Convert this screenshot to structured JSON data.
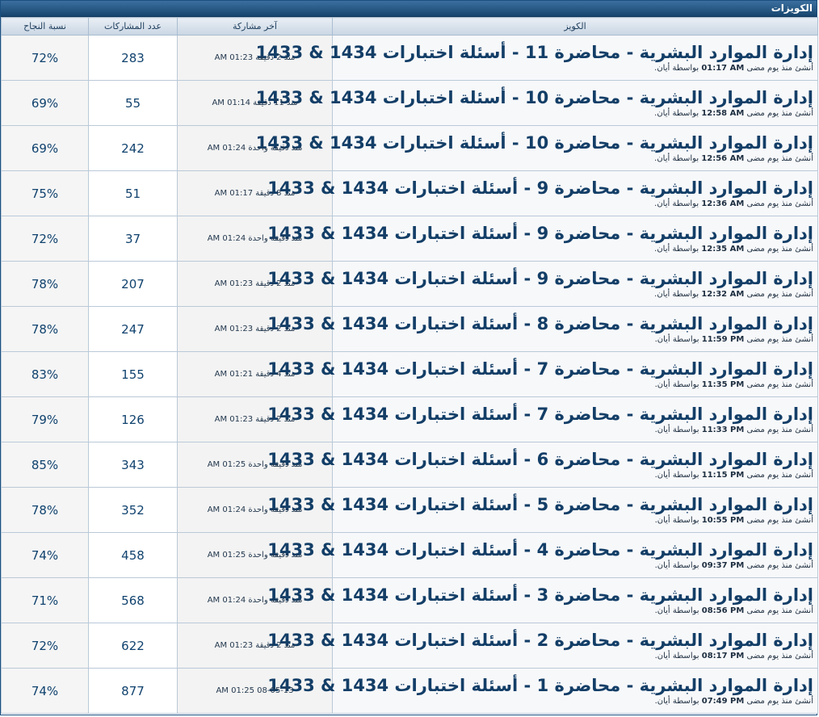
{
  "section": {
    "title": "الكويزات"
  },
  "columns": {
    "quiz": "الكويز",
    "last_post": "آخر مشاركة",
    "participants": "عدد المشاركات",
    "success_rate": "نسبة النجاح"
  },
  "rows": [
    {
      "title": "إدارة الموارد البشرية - محاضرة 11 - أسئلة اختبارات 1434 & 1433",
      "created_prefix": "أنشئ منذ يوم مضى",
      "created_time": "01:17 AM",
      "by": "بواسطة أيان.",
      "last_post": "منذ 2 دقيقة 01:23 AM",
      "participants": "283",
      "success_rate": "72%"
    },
    {
      "title": "إدارة الموارد البشرية - محاضرة 10 - أسئلة اختبارات 1434 & 1433",
      "created_prefix": "أنشئ منذ يوم مضى",
      "created_time": "12:58 AM",
      "by": "بواسطة أيان.",
      "last_post": "منذ 11 دقيقة 01:14 AM",
      "participants": "55",
      "success_rate": "69%"
    },
    {
      "title": "إدارة الموارد البشرية - محاضرة 10 - أسئلة اختبارات 1434 & 1433",
      "created_prefix": "أنشئ منذ يوم مضى",
      "created_time": "12:56 AM",
      "by": "بواسطة أيان.",
      "last_post": "منذ دقيقة واحدة 01:24 AM",
      "participants": "242",
      "success_rate": "69%"
    },
    {
      "title": "إدارة الموارد البشرية - محاضرة 9 - أسئلة اختبارات 1434 & 1433",
      "created_prefix": "أنشئ منذ يوم مضى",
      "created_time": "12:36 AM",
      "by": "بواسطة أيان.",
      "last_post": "منذ 8 دقيقة 01:17 AM",
      "participants": "51",
      "success_rate": "75%"
    },
    {
      "title": "إدارة الموارد البشرية - محاضرة 9 - أسئلة اختبارات 1434 & 1433",
      "created_prefix": "أنشئ منذ يوم مضى",
      "created_time": "12:35 AM",
      "by": "بواسطة أيان.",
      "last_post": "منذ دقيقة واحدة 01:24 AM",
      "participants": "37",
      "success_rate": "72%"
    },
    {
      "title": "إدارة الموارد البشرية - محاضرة 9 - أسئلة اختبارات 1434 & 1433",
      "created_prefix": "أنشئ منذ يوم مضى",
      "created_time": "12:32 AM",
      "by": "بواسطة أيان.",
      "last_post": "منذ 2 دقيقة 01:23 AM",
      "participants": "207",
      "success_rate": "78%"
    },
    {
      "title": "إدارة الموارد البشرية - محاضرة 8 - أسئلة اختبارات 1434 & 1433",
      "created_prefix": "أنشئ منذ يوم مضى",
      "created_time": "11:59 PM",
      "by": "بواسطة أيان.",
      "last_post": "منذ 2 دقيقة 01:23 AM",
      "participants": "247",
      "success_rate": "78%"
    },
    {
      "title": "إدارة الموارد البشرية - محاضرة 7 - أسئلة اختبارات 1434 & 1433",
      "created_prefix": "أنشئ منذ يوم مضى",
      "created_time": "11:35 PM",
      "by": "بواسطة أيان.",
      "last_post": "منذ 4 دقيقة 01:21 AM",
      "participants": "155",
      "success_rate": "83%"
    },
    {
      "title": "إدارة الموارد البشرية - محاضرة 7 - أسئلة اختبارات 1434 & 1433",
      "created_prefix": "أنشئ منذ يوم مضى",
      "created_time": "11:33 PM",
      "by": "بواسطة أيان.",
      "last_post": "منذ 2 دقيقة 01:23 AM",
      "participants": "126",
      "success_rate": "79%"
    },
    {
      "title": "إدارة الموارد البشرية - محاضرة 6 - أسئلة اختبارات 1434 & 1433",
      "created_prefix": "أنشئ منذ يوم مضى",
      "created_time": "11:15 PM",
      "by": "بواسطة أيان.",
      "last_post": "منذ دقيقة واحدة 01:25 AM",
      "participants": "343",
      "success_rate": "85%"
    },
    {
      "title": "إدارة الموارد البشرية - محاضرة 5 - أسئلة اختبارات 1434 & 1433",
      "created_prefix": "أنشئ منذ يوم مضى",
      "created_time": "10:55 PM",
      "by": "بواسطة أيان.",
      "last_post": "منذ دقيقة واحدة 01:24 AM",
      "participants": "352",
      "success_rate": "78%"
    },
    {
      "title": "إدارة الموارد البشرية - محاضرة 4 - أسئلة اختبارات 1434 & 1433",
      "created_prefix": "أنشئ منذ يوم مضى",
      "created_time": "09:37 PM",
      "by": "بواسطة أيان.",
      "last_post": "منذ دقيقة واحدة 01:25 AM",
      "participants": "458",
      "success_rate": "74%"
    },
    {
      "title": "إدارة الموارد البشرية - محاضرة 3 - أسئلة اختبارات 1434 & 1433",
      "created_prefix": "أنشئ منذ يوم مضى",
      "created_time": "08:56 PM",
      "by": "بواسطة أيان.",
      "last_post": "منذ دقيقة واحدة 01:24 AM",
      "participants": "568",
      "success_rate": "71%"
    },
    {
      "title": "إدارة الموارد البشرية - محاضرة 2 - أسئلة اختبارات 1434 & 1433",
      "created_prefix": "أنشئ منذ يوم مضى",
      "created_time": "08:17 PM",
      "by": "بواسطة أيان.",
      "last_post": "منذ 2 دقيقة 01:23 AM",
      "participants": "622",
      "success_rate": "72%"
    },
    {
      "title": "إدارة الموارد البشرية - محاضرة 1 - أسئلة اختبارات 1434 & 1433",
      "created_prefix": "أنشئ منذ يوم مضى",
      "created_time": "07:49 PM",
      "by": "بواسطة أيان.",
      "last_post": "08-05-13 01:25 AM",
      "participants": "877",
      "success_rate": "74%"
    }
  ]
}
